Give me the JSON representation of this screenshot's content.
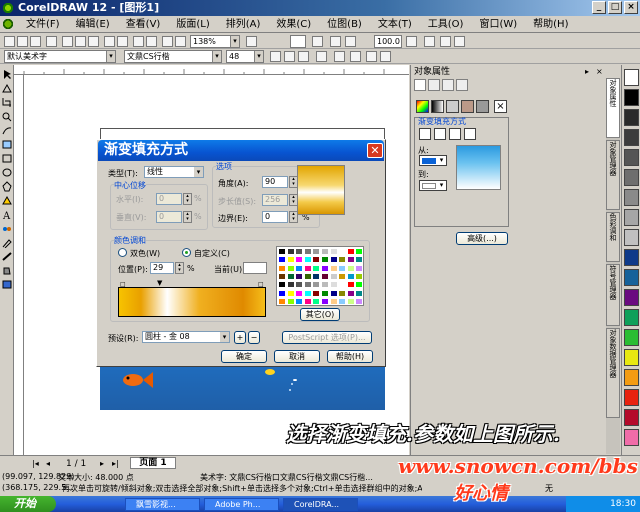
{
  "window": {
    "title": "CorelDRAW 12 - [图形1]",
    "buttons": [
      "_",
      "□",
      "×"
    ]
  },
  "menu": {
    "items": [
      "文件(F)",
      "编辑(E)",
      "查看(V)",
      "版面(L)",
      "排列(A)",
      "效果(C)",
      "位图(B)",
      "文本(T)",
      "工具(O)",
      "窗口(W)",
      "帮助(H)"
    ]
  },
  "toolbar": {
    "zoom": "138%",
    "zoom2": "100.0",
    "font": "默认美术字",
    "font_name": "文鼎CS行楷",
    "font_size": "48"
  },
  "dock": {
    "title": "对象属性",
    "fill_title": "渐变填充方式",
    "from_label": "从:",
    "to_label": "到:",
    "advanced_button": "高级(...)",
    "from_color": "#0a62d6",
    "to_color": "#ffffff"
  },
  "sidetabs": [
    "对象属性",
    "对象管理器",
    "色彩调和",
    "符号管理器",
    "对象数据管理器"
  ],
  "palette": [
    "#ffffff",
    "#000000",
    "#2a2a2a",
    "#3c3c3c",
    "#555555",
    "#6e6e6e",
    "#8a8a8a",
    "#a6a6a6",
    "#c0c0c0",
    "#0e3a8a",
    "#16629a",
    "#6a0a80",
    "#0ea05a",
    "#2abd33",
    "#e8e810",
    "#f39c12",
    "#e8230f",
    "#b40a2a",
    "#f06ca8"
  ],
  "dialog": {
    "title": "渐变填充方式",
    "type_label": "类型(T):",
    "type_value": "线性",
    "center_group": "中心位移",
    "horiz_label": "水平(I):",
    "horiz_value": "0",
    "vert_label": "垂直(V):",
    "vert_value": "0",
    "options_group": "选项",
    "angle_label": "角度(A):",
    "angle_value": "90",
    "steps_label": "步长值(S):",
    "steps_value": "256",
    "edge_label": "边界(E):",
    "edge_value": "0",
    "percent": "%",
    "blend_group": "颜色调和",
    "two_color": "双色(W)",
    "custom": "自定义(C)",
    "position_label": "位置(P):",
    "position_value": "29",
    "current_label": "当前(U):",
    "others_button": "其它(O)",
    "presets_label": "预设(R):",
    "presets_value": "圆柱 - 金 08",
    "postscript_button": "PostScript 选项(P)...",
    "ok": "确定",
    "cancel": "取消",
    "help": "帮助(H)",
    "add_preset": "+",
    "remove_preset": "−"
  },
  "status": {
    "coords": "(99.097, 129.829)",
    "text_size": "文本大小: 48.000 点",
    "coords2": "(368.175, 229.5...",
    "hint": "再次单击可旋转/倾斜对象;双击选择全部对象;Shift+单击选择多个对象;Ctrl+单击选择群组中的对象;Alt+单击...",
    "font_info": "美术字: 文鼎CS行楷口文鼎CS行楷文鼎CS行楷...",
    "page_count": "1 / 1",
    "page_tab": "页面 1",
    "none_label": "无"
  },
  "overlay": {
    "caption": "选择渐变填充.参数如上图所示.",
    "site": "www.snowcn.com/bbs",
    "author": "好心情"
  },
  "taskbar": {
    "start": "开始",
    "tasks": [
      "飘雪影视...",
      "Adobe Ph...",
      "CorelDRA..."
    ],
    "time": "18:30"
  }
}
